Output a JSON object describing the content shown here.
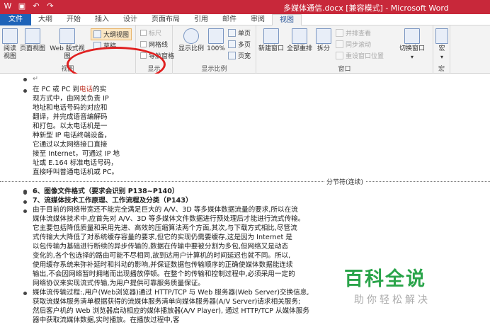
{
  "window": {
    "title": "多媒体通信.docx [兼容模式] - Microsoft Word"
  },
  "qat": [
    "word-icon",
    "save-icon",
    "undo-icon",
    "redo-icon"
  ],
  "tabs": [
    {
      "label": "文件"
    },
    {
      "label": "大纲"
    },
    {
      "label": "开始"
    },
    {
      "label": "插入"
    },
    {
      "label": "设计"
    },
    {
      "label": "页面布局"
    },
    {
      "label": "引用"
    },
    {
      "label": "邮件"
    },
    {
      "label": "审阅"
    },
    {
      "label": "视图"
    }
  ],
  "ribbon": {
    "views": {
      "label": "视图",
      "read_mode": "阅读\n视图",
      "print_layout": "页面视图",
      "web_layout": "Web 版式视图",
      "outline": "大纲视图",
      "draft": "草稿"
    },
    "show": {
      "label": "显示",
      "ruler": "标尺",
      "gridlines": "网格线",
      "nav_pane": "导航窗格"
    },
    "zoom": {
      "label": "显示比例",
      "zoom": "显示比例",
      "hundred": "100%",
      "one_page": "单页",
      "multi_page": "多页",
      "page_width": "页宽"
    },
    "window": {
      "label": "窗口",
      "new_window": "新建窗口",
      "arrange_all": "全部重排",
      "split": "拆分",
      "side_by_side": "并排查看",
      "sync_scroll": "同步滚动",
      "reset_pos": "重设窗口位置",
      "switch_windows": "切换窗口"
    },
    "macros": {
      "label": "宏",
      "macros": "宏"
    }
  },
  "document": {
    "para1": [
      "在 PC 或 PC 到电话的实",
      "现方式中，由网关负责 IP",
      "地址和电话号码的对应和",
      "翻译，并完成语音编解码",
      "和打包。以太电话机是一",
      "种新型 IP 电话终端设备，",
      "它通过以太网络接口直接",
      "接至 Internet，可通过 IP 地",
      "址或 E.164 标准电话号码，",
      "直接呼叫普通电话机或 PC。"
    ],
    "link_word": "电话",
    "section_break": "分节符(连续)",
    "heading6": "6、图像文件格式（要求会识别 P138~P140）",
    "heading7": "7、流媒体技术工作原理、工作流程及分类（P143）",
    "para2": [
      "由于目前的网络带宽还不能完全满足巨大的 A/V、3D 等多媒体数据流量的要求,所以在流",
      "媒体流媒体技术中,应首先对 A/V、3D 等多媒体文件数据进行预处理后才能进行流式传输。",
      "它主要包括降低质量和采用先进、高效的压缩算法两个方面,其次,与下载方式相比,尽管流",
      "式传输大大降低了对系统缓存容量的要求,但它的实现仍需要缓存,这是因为 Internet 是",
      "以包传输为基础进行断续的异步传输的,数据在传输中要被分割为多包,但网络又是动态",
      "变化的,各个包选择的路由可能不尽相同,故到达用户计算机的时间延迟也就不同。所以,",
      "使用缓存系统来弥补延时和抖动的影响,并保证数据包传输顺序的正确使媒体数据能连续",
      "输出,不会因网络暂时拥堵而出现播放停顿。在整个的传输和控制过程中,必须采用一定的",
      "网络协议来实现流式传输,为用户提供可靠服务质量保证。"
    ],
    "para3": [
      "媒体流传输过程:,用户(Web浏览器)通过  HTTP/TCP 与 Web 服务器(Web Server)交换信息,",
      "获取流媒体服务清单根据获得的流媒体服务清单向媒体服务器(A/V Server)请求相关服务;",
      "然后客户机的 Web 浏览器启动相应的媒体播放器(A/V Player), 通过 HTTP/TCP 从媒体服务",
      "器中获取流媒体数据,实时播放。在播放过程中,客"
    ]
  },
  "watermark": {
    "title": "百科全说",
    "subtitle": "助你轻松解决"
  },
  "colors": {
    "title_bar": "#c8283a",
    "file_tab": "#1e63b8",
    "highlight_oval": "#e02020",
    "watermark_green": "#2aa44a"
  }
}
